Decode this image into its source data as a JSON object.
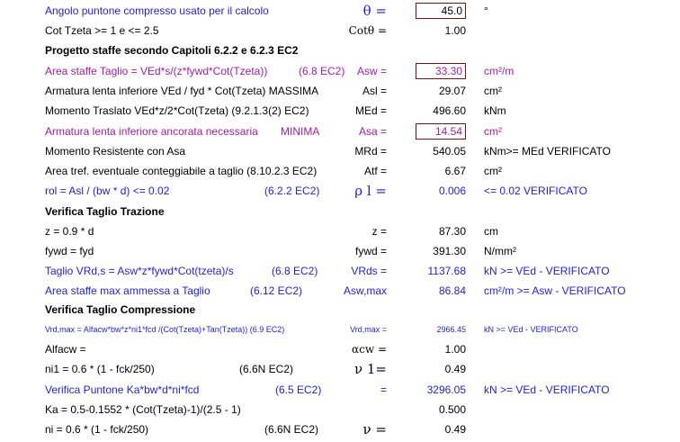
{
  "rows": [
    {
      "desc": "Angolo puntone compresso usato per il calcolo",
      "ref": "",
      "sym": "θ =",
      "val": "45.0",
      "unit": "°"
    },
    {
      "desc": "Cot Tzeta >= 1 e <= 2.5",
      "ref": "",
      "sym": "Cotθ =",
      "val": "1.00",
      "unit": ""
    },
    {
      "desc": "Progetto staffe secondo Capitoli 6.2.2 e 6.2.3 EC2",
      "ref": "",
      "sym": "",
      "val": "",
      "unit": ""
    },
    {
      "desc": "Area staffe Taglio = VEd*s/(z*fywd*Cot(Tzeta))",
      "ref": "(6.8 EC2)",
      "sym": "Asw =",
      "val": "33.30",
      "unit": "cm²/m"
    },
    {
      "desc": "Armatura lenta inferiore  VEd / fyd * Cot(Tzeta) MASSIMA",
      "ref": "",
      "sym": "Asl =",
      "val": "29.07",
      "unit": "cm²"
    },
    {
      "desc": "Momento Traslato  VEd*z/2*Cot(Tzeta)   (9.2.1.3(2) EC2)",
      "ref": "",
      "sym": "MEd =",
      "val": "496.60",
      "unit": "kNm"
    },
    {
      "desc": "Armatura lenta inferiore ancorata necessaria",
      "ref": "MINIMA",
      "sym": "Asa =",
      "val": "14.54",
      "unit": "cm²"
    },
    {
      "desc": "Momento Resistente con Asa",
      "ref": "",
      "sym": "MRd =",
      "val": "540.05",
      "unit": "kNm>= MEd  VERIFICATO"
    },
    {
      "desc": "Area tref. eventuale conteggiabile a taglio (8.10.2.3 EC2)",
      "ref": "",
      "sym": "Atf =",
      "val": "6.67",
      "unit": "cm²"
    },
    {
      "desc": "rol = Asl / (bw * d) <= 0.02",
      "ref": "(6.2.2 EC2)",
      "sym": "ρ l =",
      "val": "0.006",
      "unit": "<= 0.02 VERIFICATO"
    },
    {
      "desc": "Verifica Taglio Trazione",
      "ref": "",
      "sym": "",
      "val": "",
      "unit": ""
    },
    {
      "desc": "z = 0.9 * d",
      "ref": "",
      "sym": "z =",
      "val": "87.30",
      "unit": "cm"
    },
    {
      "desc": "fywd =  fyd",
      "ref": "",
      "sym": "fywd =",
      "val": "391.30",
      "unit": "N/mm²"
    },
    {
      "desc": "Taglio  VRd,s = Asw*z*fywd*Cot(tzeta)/s",
      "ref": "(6.8 EC2)",
      "sym": "VRds =",
      "val": "1137.68",
      "unit": "kN >= VEd - VERIFICATO"
    },
    {
      "desc": "Area staffe max ammessa a Taglio",
      "ref": "(6.12 EC2)",
      "sym": "Asw,max",
      "val": "86.84",
      "unit": "cm²/m >= Asw - VERIFICATO"
    },
    {
      "desc": "Verifica Taglio Compressione",
      "ref": "",
      "sym": "",
      "val": "",
      "unit": ""
    },
    {
      "desc": "Vrd,max = Alfacw*bw*z*ni1*fcd /(Cot(Tzeta)+Tan(Tzeta)) (6.9 EC2)",
      "ref": "",
      "sym": "Vrd,max =",
      "val": "2966.45",
      "unit": "kN >= VEd - VERIFICATO"
    },
    {
      "desc": "Alfacw =",
      "ref": "",
      "sym": "αcw =",
      "val": "1.00",
      "unit": ""
    },
    {
      "desc": "ni1 = 0.6 * (1 - fck/250)",
      "ref": "(6.6N EC2)",
      "sym": "ν 1=",
      "val": "0.49",
      "unit": ""
    },
    {
      "desc": "Verifica Puntone Ka*bw*d*ni*fcd",
      "ref": "(6.5 EC2)",
      "sym": "=",
      "val": "3296.05",
      "unit": "kN >= VEd - VERIFICATO"
    },
    {
      "desc": "Ka = 0.5-0.1552 * (Cot(Tzeta)-1)/(2.5 - 1)",
      "ref": "",
      "sym": "",
      "val": "0.500",
      "unit": ""
    },
    {
      "desc": "ni = 0.6 * (1 - fck/250)",
      "ref": "(6.6N EC2)",
      "sym": "ν =",
      "val": "0.49",
      "unit": ""
    }
  ],
  "colors": {
    "blue": "#1f1fd6",
    "purple": "#a21ca2",
    "box_border": "#7a1010"
  }
}
